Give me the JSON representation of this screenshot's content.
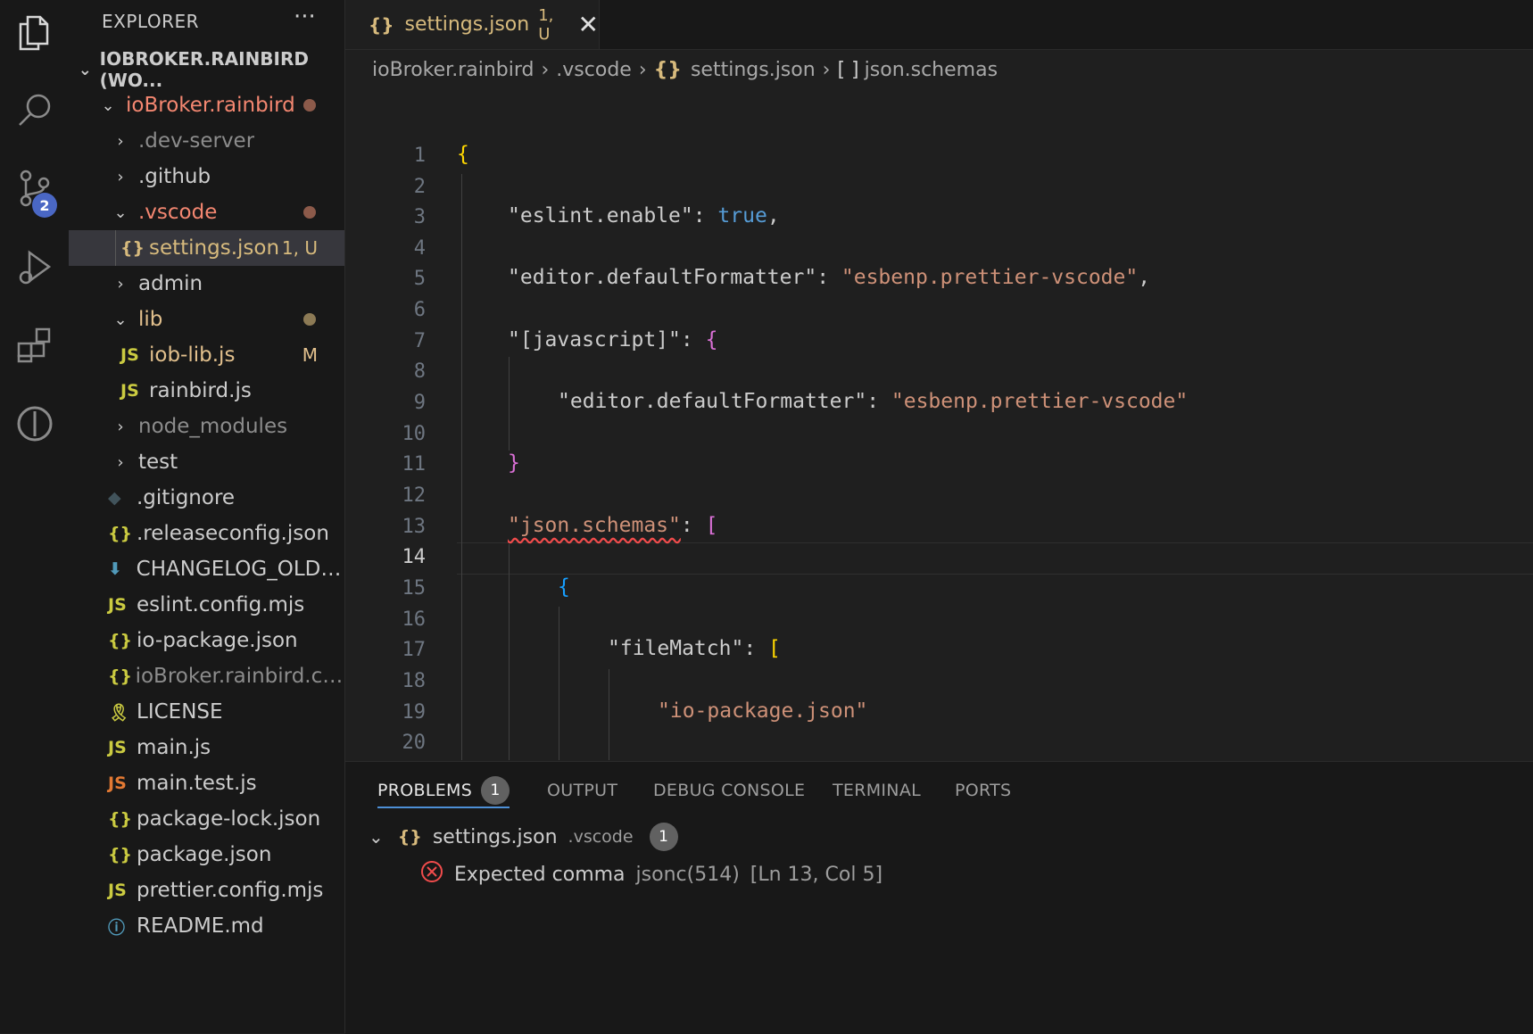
{
  "sidebar": {
    "title": "EXPLORER",
    "more_label": "···",
    "workspace": "IOBROKER.RAINBIRD (WO...",
    "tree": [
      {
        "label": "ioBroker.rainbird",
        "type": "folder-open",
        "color": "#f48771"
      },
      {
        "label": ".dev-server",
        "type": "folder",
        "color": "#8c8c8c"
      },
      {
        "label": ".github",
        "type": "folder",
        "color": "#cccccc"
      },
      {
        "label": ".vscode",
        "type": "folder-open",
        "color": "#f48771"
      },
      {
        "label": "settings.json",
        "type": "json",
        "status": "1, U",
        "color": "#d7ba7d"
      },
      {
        "label": "admin",
        "type": "folder",
        "color": "#cccccc"
      },
      {
        "label": "lib",
        "type": "folder-open",
        "color": "#e2c08d"
      },
      {
        "label": "iob-lib.js",
        "type": "js",
        "status": "M",
        "color": "#e2c08d"
      },
      {
        "label": "rainbird.js",
        "type": "js",
        "color": "#cccccc"
      },
      {
        "label": "node_modules",
        "type": "folder",
        "color": "#8c8c8c"
      },
      {
        "label": "test",
        "type": "folder",
        "color": "#cccccc"
      },
      {
        "label": ".gitignore",
        "type": "git",
        "color": "#cccccc"
      },
      {
        "label": ".releaseconfig.json",
        "type": "json",
        "color": "#cccccc"
      },
      {
        "label": "CHANGELOG_OLD....",
        "type": "md-down",
        "color": "#cccccc"
      },
      {
        "label": "eslint.config.mjs",
        "type": "js",
        "color": "#cccccc"
      },
      {
        "label": "io-package.json",
        "type": "json",
        "color": "#cccccc"
      },
      {
        "label": "ioBroker.rainbird.co...",
        "type": "json",
        "color": "#8c8c8c"
      },
      {
        "label": "LICENSE",
        "type": "license",
        "color": "#cccccc"
      },
      {
        "label": "main.js",
        "type": "js",
        "color": "#cccccc"
      },
      {
        "label": "main.test.js",
        "type": "js-test",
        "color": "#cccccc"
      },
      {
        "label": "package-lock.json",
        "type": "json",
        "color": "#cccccc"
      },
      {
        "label": "package.json",
        "type": "json",
        "color": "#cccccc"
      },
      {
        "label": "prettier.config.mjs",
        "type": "js",
        "color": "#cccccc"
      },
      {
        "label": "README.md",
        "type": "info",
        "color": "#cccccc"
      }
    ]
  },
  "activity": {
    "scm_badge": "2"
  },
  "tab": {
    "icon": "{}",
    "label": "settings.json",
    "badge": "1, U",
    "close": "✕"
  },
  "breadcrumb": {
    "parts": [
      "ioBroker.rainbird",
      ".vscode",
      "settings.json",
      "json.schemas"
    ],
    "json_icon": "{}",
    "array_icon": "[ ]"
  },
  "editor": {
    "active_line": "14",
    "line_numbers": [
      "1",
      "2",
      "3",
      "4",
      "5",
      "6",
      "7",
      "8",
      "9",
      "10",
      "11",
      "12",
      "13",
      "14",
      "15",
      "16",
      "17",
      "18",
      "19",
      "20"
    ],
    "code": {
      "l1": "{",
      "l3_key": "\"eslint.enable\"",
      "l3_val": "true",
      "l5_key": "\"editor.defaultFormatter\"",
      "l5_val": "\"esbenp.prettier-vscode\"",
      "l7_key": "\"[javascript]\"",
      "l9_key": "\"editor.defaultFormatter\"",
      "l9_val": "\"esbenp.prettier-vscode\"",
      "l11": "}",
      "l13_key": "\"json.schemas\"",
      "l13_br": "[",
      "l15": "{",
      "l17_key": "\"fileMatch\"",
      "l17_br": "[",
      "l19_val": "\"io-package.json\""
    }
  },
  "panel": {
    "tabs": [
      "PROBLEMS",
      "OUTPUT",
      "DEBUG CONSOLE",
      "TERMINAL",
      "PORTS"
    ],
    "problems_count": "1",
    "file": {
      "name": "settings.json",
      "dir": ".vscode",
      "count": "1"
    },
    "problem": {
      "message": "Expected comma",
      "source": "jsonc(514)",
      "location": "[Ln 13, Col 5]"
    }
  },
  "colors": {
    "accent": "#4d8fd6",
    "modified": "#e2c08d",
    "untracked": "#d7ba7d",
    "error": "#f14c4c"
  }
}
